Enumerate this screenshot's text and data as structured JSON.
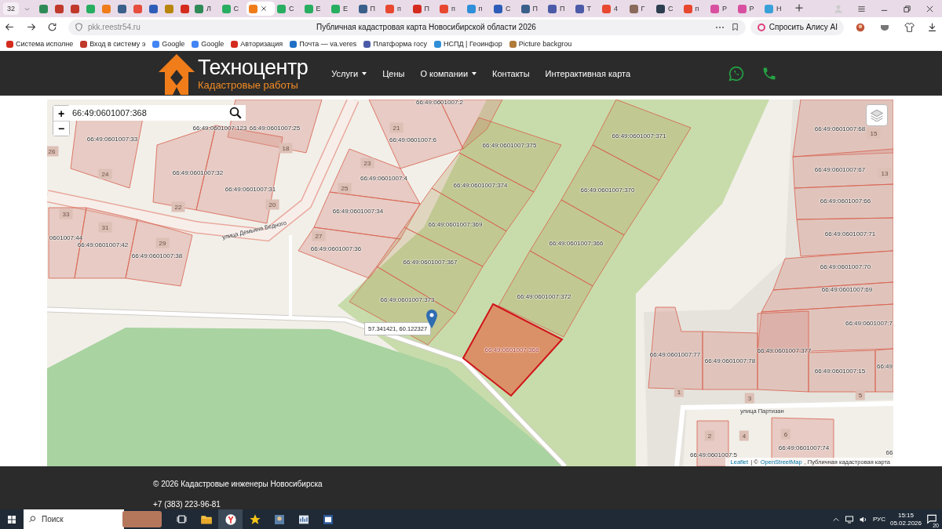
{
  "browser": {
    "tab_count": "32",
    "tabs": [
      {
        "color": "#2e8b57",
        "selected": false
      },
      {
        "color": "#c0392b",
        "selected": false
      },
      {
        "color": "#c0392b",
        "selected": false
      },
      {
        "color": "#27ae60",
        "selected": false
      },
      {
        "color": "#f07d1a",
        "selected": false
      },
      {
        "color": "#3a5f8a",
        "selected": false
      },
      {
        "color": "#e74c3c",
        "selected": false
      },
      {
        "color": "#2d5db8",
        "selected": false
      },
      {
        "color": "#b8860b",
        "selected": false
      },
      {
        "color": "#d52b1e",
        "selected": false
      },
      {
        "label": "Л",
        "color": "#2e8b57",
        "selected": false
      },
      {
        "label": "С",
        "color": "#27ae60",
        "selected": false
      },
      {
        "color": "#f07d1a",
        "selected": true
      },
      {
        "label": "С",
        "color": "#27ae60",
        "selected": false
      },
      {
        "label": "Е",
        "color": "#27ae60",
        "selected": false
      },
      {
        "label": "Е",
        "color": "#27ae60",
        "selected": false
      },
      {
        "label": "П",
        "color": "#3a5f8a",
        "selected": false
      },
      {
        "label": "п",
        "color": "#e8482f",
        "selected": false
      },
      {
        "label": "П",
        "color": "#d52b1e",
        "selected": false
      },
      {
        "label": "п",
        "color": "#e8482f",
        "selected": false
      },
      {
        "label": "п",
        "color": "#2f8fd8",
        "selected": false
      },
      {
        "label": "С",
        "color": "#2d5db8",
        "selected": false
      },
      {
        "label": "П",
        "color": "#3a5f8a",
        "selected": false
      },
      {
        "label": "П",
        "color": "#4b5ba8",
        "selected": false
      },
      {
        "label": "Т",
        "color": "#4b5ba8",
        "selected": false
      },
      {
        "label": "4",
        "color": "#e8482f",
        "selected": false
      },
      {
        "label": "Г",
        "color": "#8a6a5a",
        "selected": false
      },
      {
        "label": "С",
        "color": "#2c3e50",
        "selected": false
      },
      {
        "label": "п",
        "color": "#e8482f",
        "selected": false
      },
      {
        "label": "Р",
        "color": "#d94fa0",
        "selected": false
      },
      {
        "label": "Р",
        "color": "#d94fa0",
        "selected": false
      },
      {
        "label": "Н",
        "color": "#3aa0d8",
        "selected": false
      }
    ],
    "address": "pkk.reestr54.ru",
    "page_title": "Публичная кадастровая карта Новосибирской области 2026",
    "alice_button": "Спросить Алису AI",
    "bookmarks": [
      {
        "label": "Система исполне",
        "color": "#d52b1e"
      },
      {
        "label": "Вход в систему э",
        "color": "#c0392b"
      },
      {
        "label": "Google",
        "color": "#4285f4"
      },
      {
        "label": "Google",
        "color": "#4285f4"
      },
      {
        "label": "Авторизация",
        "color": "#d52b1e"
      },
      {
        "label": "Почта — va.veres",
        "color": "#1f6fc5"
      },
      {
        "label": "Платформа госу",
        "color": "#4b5ba8"
      },
      {
        "label": "НСПД | Геоинфор",
        "color": "#2f8fd8"
      },
      {
        "label": "Picture backgrou",
        "color": "#b07a3a"
      }
    ]
  },
  "site_header": {
    "logo_title": "Техноцентр",
    "logo_subtitle": "Кадастровые работы",
    "nav": [
      {
        "label": "Услуги",
        "dropdown": true
      },
      {
        "label": "Цены",
        "dropdown": false
      },
      {
        "label": "О компании",
        "dropdown": true
      },
      {
        "label": "Контакты",
        "dropdown": false
      },
      {
        "label": "Интерактивная карта",
        "dropdown": false
      }
    ]
  },
  "map": {
    "search": {
      "value": "66:49:0601007:368"
    },
    "zoom_in": "+",
    "zoom_out": "−",
    "parcels": [
      {
        "number": "66:49:0601007:2",
        "selected": false
      },
      {
        "number": "66:49:0601007:123",
        "selected": false
      },
      {
        "number": "66:49:0601007:25",
        "selected": false
      },
      {
        "number": "66:49:0601007:33",
        "selected": false
      },
      {
        "number": "66:49:0601007:6",
        "selected": false
      },
      {
        "number": "66:49:0601007:375",
        "selected": false
      },
      {
        "number": "66:49:0601007:371",
        "selected": false
      },
      {
        "number": "66:49:0601007:68",
        "selected": false
      },
      {
        "number": "66:49:0601007:67",
        "selected": false
      },
      {
        "number": "66:49:0601007:32",
        "selected": false
      },
      {
        "number": "66:49:0601007:4",
        "selected": false
      },
      {
        "number": "66:49:0601007:374",
        "selected": false
      },
      {
        "number": "66:49:0601007:370",
        "selected": false
      },
      {
        "number": "66:49:0601007:66",
        "selected": false
      },
      {
        "number": "66:49:0601007:31",
        "selected": false
      },
      {
        "number": "66:49:0601007:34",
        "selected": false
      },
      {
        "number": "66:49:0601007:369",
        "selected": false
      },
      {
        "number": "66:49:0601007:71",
        "selected": false
      },
      {
        "number": "0601007:44",
        "selected": false
      },
      {
        "number": "66:49:0601007:42",
        "selected": false
      },
      {
        "number": "66:49:0601007:38",
        "selected": false
      },
      {
        "number": "66:49:0601007:36",
        "selected": false
      },
      {
        "number": "66:49:0601007:366",
        "selected": false
      },
      {
        "number": "66:49:0601007:367",
        "selected": false
      },
      {
        "number": "66:49:0601007:70",
        "selected": false
      },
      {
        "number": "66:49:0601007:373",
        "selected": false
      },
      {
        "number": "66:49:0601007:372",
        "selected": false
      },
      {
        "number": "66:49:0601007:69",
        "selected": false
      },
      {
        "number": "66:49:0601007:7",
        "selected": false
      },
      {
        "number": "66:49:0601007:368",
        "selected": true
      },
      {
        "number": "66:49:0601007:77",
        "selected": false
      },
      {
        "number": "66:49:0601007:78",
        "selected": false
      },
      {
        "number": "66:49:0601007:377",
        "selected": false
      },
      {
        "number": "66:49:0601007:15",
        "selected": false
      },
      {
        "number": "66:49",
        "selected": false
      },
      {
        "number": "66:49:0601007:5",
        "selected": false
      },
      {
        "number": "66:49:0601007:74",
        "selected": false
      },
      {
        "number": "66",
        "selected": false
      }
    ],
    "house_numbers": [
      "26",
      "24",
      "18",
      "21",
      "23",
      "25",
      "22",
      "20",
      "33",
      "31",
      "29",
      "27",
      "15",
      "13",
      "1",
      "3",
      "5",
      "2",
      "4",
      "6"
    ],
    "streets": [
      "улица Демьяна Бедного",
      "улица Партизан"
    ],
    "marker_popup": "57.341421, 60.122327",
    "attribution": [
      {
        "text": "Leaflet",
        "kind": "link"
      },
      {
        "text": "| ©",
        "kind": "text"
      },
      {
        "text": "OpenStreetMap",
        "kind": "link"
      },
      {
        "text": ", Публичная кадастровая карта",
        "kind": "text"
      }
    ]
  },
  "footer": {
    "copyright": "© 2026 Кадастровые инженеры Новосибирска",
    "phone": "+7 (383) 223-96-81"
  },
  "taskbar": {
    "search_placeholder": "Поиск",
    "language": "РУС",
    "time": "15:15",
    "date": "05.02.2026",
    "notifications": "20"
  }
}
